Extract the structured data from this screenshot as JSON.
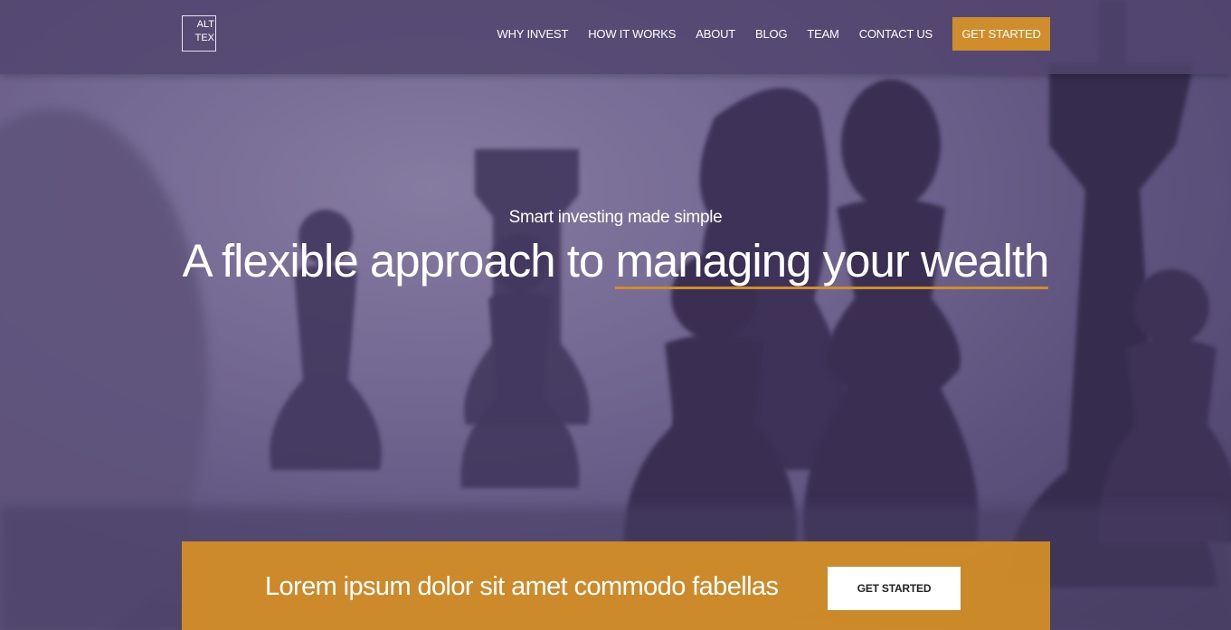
{
  "logo": {
    "alt_text": "ALT TEX"
  },
  "nav": {
    "items": [
      {
        "label": "WHY INVEST"
      },
      {
        "label": "HOW IT WORKS"
      },
      {
        "label": "ABOUT"
      },
      {
        "label": "BLOG"
      },
      {
        "label": "TEAM"
      },
      {
        "label": "CONTACT US"
      }
    ],
    "cta_label": "GET STARTED"
  },
  "hero": {
    "tagline": "Smart investing made simple",
    "headline_prefix": "A flexible approach to",
    "headline_accent": "managing your wealth"
  },
  "cta_banner": {
    "text": "Lorem ipsum dolor sit amet commodo fabellas",
    "button_label": "GET STARTED"
  },
  "colors": {
    "accent": "#d08d2b",
    "navbar": "#50446e",
    "overlay": "#6a5f8a"
  },
  "icons": {
    "logo": "broken-image-icon"
  }
}
